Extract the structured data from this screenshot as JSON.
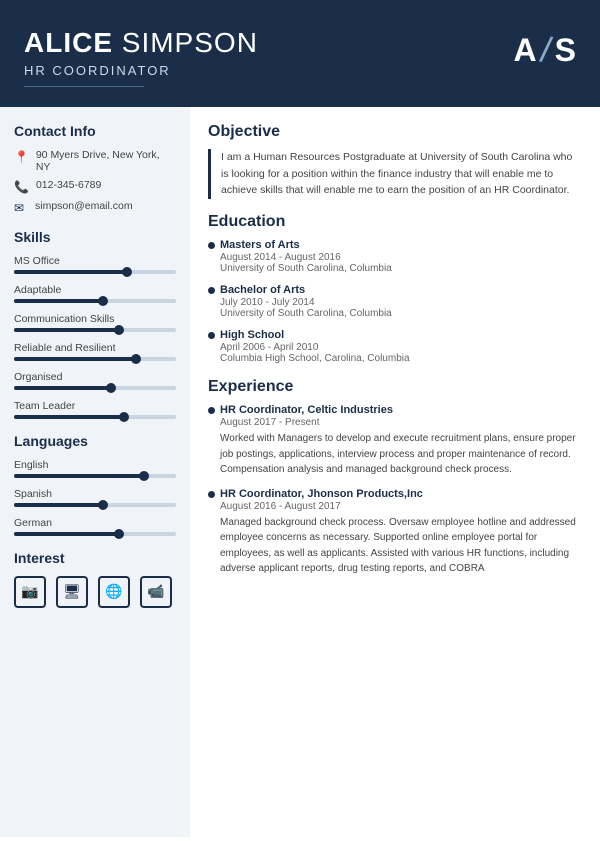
{
  "header": {
    "first_name": "ALICE",
    "last_name": " SIMPSON",
    "title": "HR COORDINATOR",
    "monogram_a": "A",
    "monogram_s": "S",
    "monogram_slash": "/"
  },
  "contact": {
    "section_label": "Contact Info",
    "address": "90 Myers Drive, New York, NY",
    "phone": "012-345-6789",
    "email": "simpson@email.com"
  },
  "skills": {
    "section_label": "Skills",
    "items": [
      {
        "label": "MS Office",
        "fill": 70,
        "dot": 70
      },
      {
        "label": "Adaptable",
        "fill": 55,
        "dot": 55
      },
      {
        "label": "Communication Skills",
        "fill": 65,
        "dot": 65
      },
      {
        "label": "Reliable and Resilient",
        "fill": 75,
        "dot": 75
      },
      {
        "label": "Organised",
        "fill": 60,
        "dot": 60
      },
      {
        "label": "Team Leader",
        "fill": 68,
        "dot": 68
      }
    ]
  },
  "languages": {
    "section_label": "Languages",
    "items": [
      {
        "label": "English",
        "fill": 80,
        "dot": 80
      },
      {
        "label": "Spanish",
        "fill": 55,
        "dot": 55
      },
      {
        "label": "German",
        "fill": 65,
        "dot": 65
      }
    ]
  },
  "interest": {
    "section_label": "Interest",
    "icons": [
      {
        "name": "camera-icon",
        "symbol": "📷"
      },
      {
        "name": "computer-icon",
        "symbol": "🖥"
      },
      {
        "name": "globe-icon",
        "symbol": "🌐"
      },
      {
        "name": "video-icon",
        "symbol": "📹"
      }
    ]
  },
  "objective": {
    "section_label": "Objective",
    "text": "I am a Human Resources Postgraduate at University of South Carolina who is looking for a position within the finance industry that will enable me to achieve skills that will enable me to earn the position of an HR Coordinator."
  },
  "education": {
    "section_label": "Education",
    "items": [
      {
        "degree": "Masters of Arts",
        "dates": "August 2014 - August 2016",
        "org": "University of South Carolina, Columbia"
      },
      {
        "degree": "Bachelor of Arts",
        "dates": "July 2010 - July 2014",
        "org": "University of South Carolina, Columbia"
      },
      {
        "degree": "High School",
        "dates": "April 2006 - April 2010",
        "org": "Columbia High School, Carolina, Columbia"
      }
    ]
  },
  "experience": {
    "section_label": "Experience",
    "items": [
      {
        "title": "HR Coordinator",
        "company": "Celtic Industries",
        "dates": "August 2017 - Present",
        "desc": "Worked with Managers to develop and execute recruitment plans, ensure proper job postings, applications, interview process and proper maintenance of record. Compensation analysis and managed background check process."
      },
      {
        "title": "HR Coordinator",
        "company": "Jhonson Products,Inc",
        "dates": "August 2016 - August 2017",
        "desc": "Managed background check process. Oversaw employee hotline and addressed employee concerns as necessary. Supported online employee portal for employees, as well as applicants. Assisted with various HR functions, including adverse applicant reports, drug testing reports, and COBRA"
      }
    ]
  }
}
